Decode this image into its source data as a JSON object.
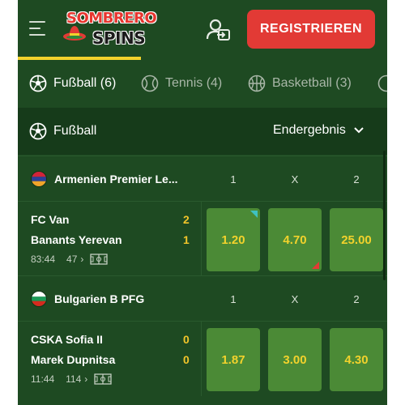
{
  "header": {
    "logo_line1": "SOMBRERO",
    "logo_line2": "SPINS",
    "register_label": "REGISTRIEREN"
  },
  "sport_tabs": [
    {
      "label": "Fußball (6)",
      "icon": "soccer-ball-icon",
      "active": true
    },
    {
      "label": "Tennis (4)",
      "icon": "tennis-ball-icon",
      "active": false
    },
    {
      "label": "Basketball (3)",
      "icon": "basketball-icon",
      "active": false
    }
  ],
  "section": {
    "title": "Fußball",
    "market_select": "Endergebnis"
  },
  "leagues": [
    {
      "name": "Armenien Premier Le...",
      "flag": "armenia",
      "columns": [
        "1",
        "X",
        "2"
      ],
      "matches": [
        {
          "home": "FC Van",
          "away": "Banants Yerevan",
          "home_score": "2",
          "away_score": "1",
          "time": "83:44",
          "markets": "47",
          "odds": [
            "1.20",
            "4.70",
            "25.00"
          ]
        }
      ]
    },
    {
      "name": "Bulgarien B PFG",
      "flag": "bulgaria",
      "columns": [
        "1",
        "X",
        "2"
      ],
      "matches": [
        {
          "home": "CSKA Sofia II",
          "away": "Marek Dupnitsa",
          "home_score": "0",
          "away_score": "0",
          "time": "11:44",
          "markets": "114",
          "odds": [
            "1.87",
            "3.00",
            "4.30"
          ]
        }
      ]
    }
  ],
  "colors": {
    "background": "#1e4a22",
    "section_bg": "#163b1a",
    "odds_bg": "#4b8a36",
    "odds_text": "#f2d22c",
    "register_button": "#e23a35",
    "score": "#f2c52a",
    "odds_up": "#3fc1c1",
    "odds_down": "#e23a35"
  }
}
